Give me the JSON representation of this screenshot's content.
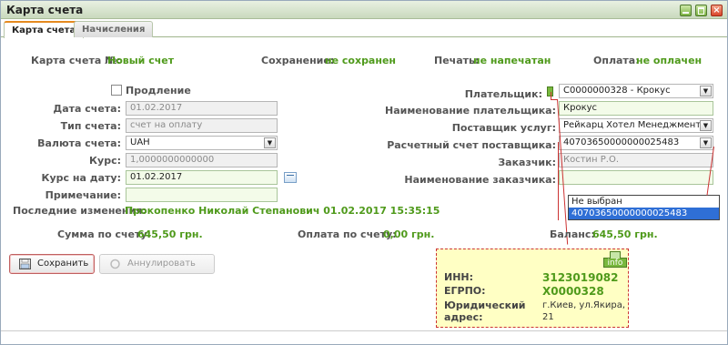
{
  "window": {
    "title": "Карта счета"
  },
  "tabs": [
    {
      "label": "Карта счета"
    },
    {
      "label": "Начисления"
    }
  ],
  "summary": {
    "card_label": "Карта счета №:",
    "card_value": "Новый счет",
    "save_label": "Сохранение:",
    "save_value": "не сохранен",
    "print_label": "Печать:",
    "print_value": "не напечатан",
    "pay_label": "Оплата:",
    "pay_value": "не оплачен"
  },
  "left": {
    "prolong_label": "Продление",
    "date_label": "Дата счета:",
    "date_value": "01.02.2017",
    "type_label": "Тип счета:",
    "type_value": "счет на оплату",
    "currency_label": "Валюта счета:",
    "currency_value": "UAH",
    "rate_label": "Курс:",
    "rate_value": "1,0000000000000",
    "rate_date_label": "Курс на дату:",
    "rate_date_value": "01.02.2017",
    "note_label": "Примечание:",
    "note_value": ""
  },
  "right": {
    "payer_label": "Плательщик:",
    "payer_value": "C0000000328 - Крокус",
    "payer_name_label": "Наименование плательщика:",
    "payer_name_value": "Крокус",
    "supplier_label": "Поставщик услуг:",
    "supplier_value": "Рейкарц Хотел Менеджмент",
    "account_label": "Расчетный счет поставщика:",
    "account_value": "40703650000000025483",
    "customer_label": "Заказчик:",
    "customer_value": "Костин Р.О.",
    "customer_name_label": "Наименование заказчика:",
    "customer_name_value": ""
  },
  "last_change": {
    "label": "Последние изменения:",
    "value": "Прокопенко Николай Степанович 01.02.2017 15:35:15"
  },
  "totals": {
    "sum_label": "Сумма по счету:",
    "sum_value": "645,50 грн.",
    "paid_label": "Оплата по счету:",
    "paid_value": "0,00 грн.",
    "balance_label": "Баланс:",
    "balance_value": "645,50 грн."
  },
  "buttons": {
    "save": "Сохранить",
    "cancel": "Аннулировать"
  },
  "account_dropdown": {
    "options": [
      "Не выбран",
      "40703650000000025483"
    ],
    "selected_index": 1
  },
  "tooltip": {
    "badge": "info",
    "inn_label": "ИНН:",
    "inn_value": "3123019082",
    "egrpo_label": "ЕГРПО:",
    "egrpo_value": "X0000328",
    "address_label_1": "Юридический",
    "address_label_2": "адрес:",
    "address_value_1": "г.Киев, ул.Якира,",
    "address_value_2": "21"
  },
  "colors": {
    "accent_green": "#4f9a1b",
    "alert_red": "#cc3333"
  }
}
